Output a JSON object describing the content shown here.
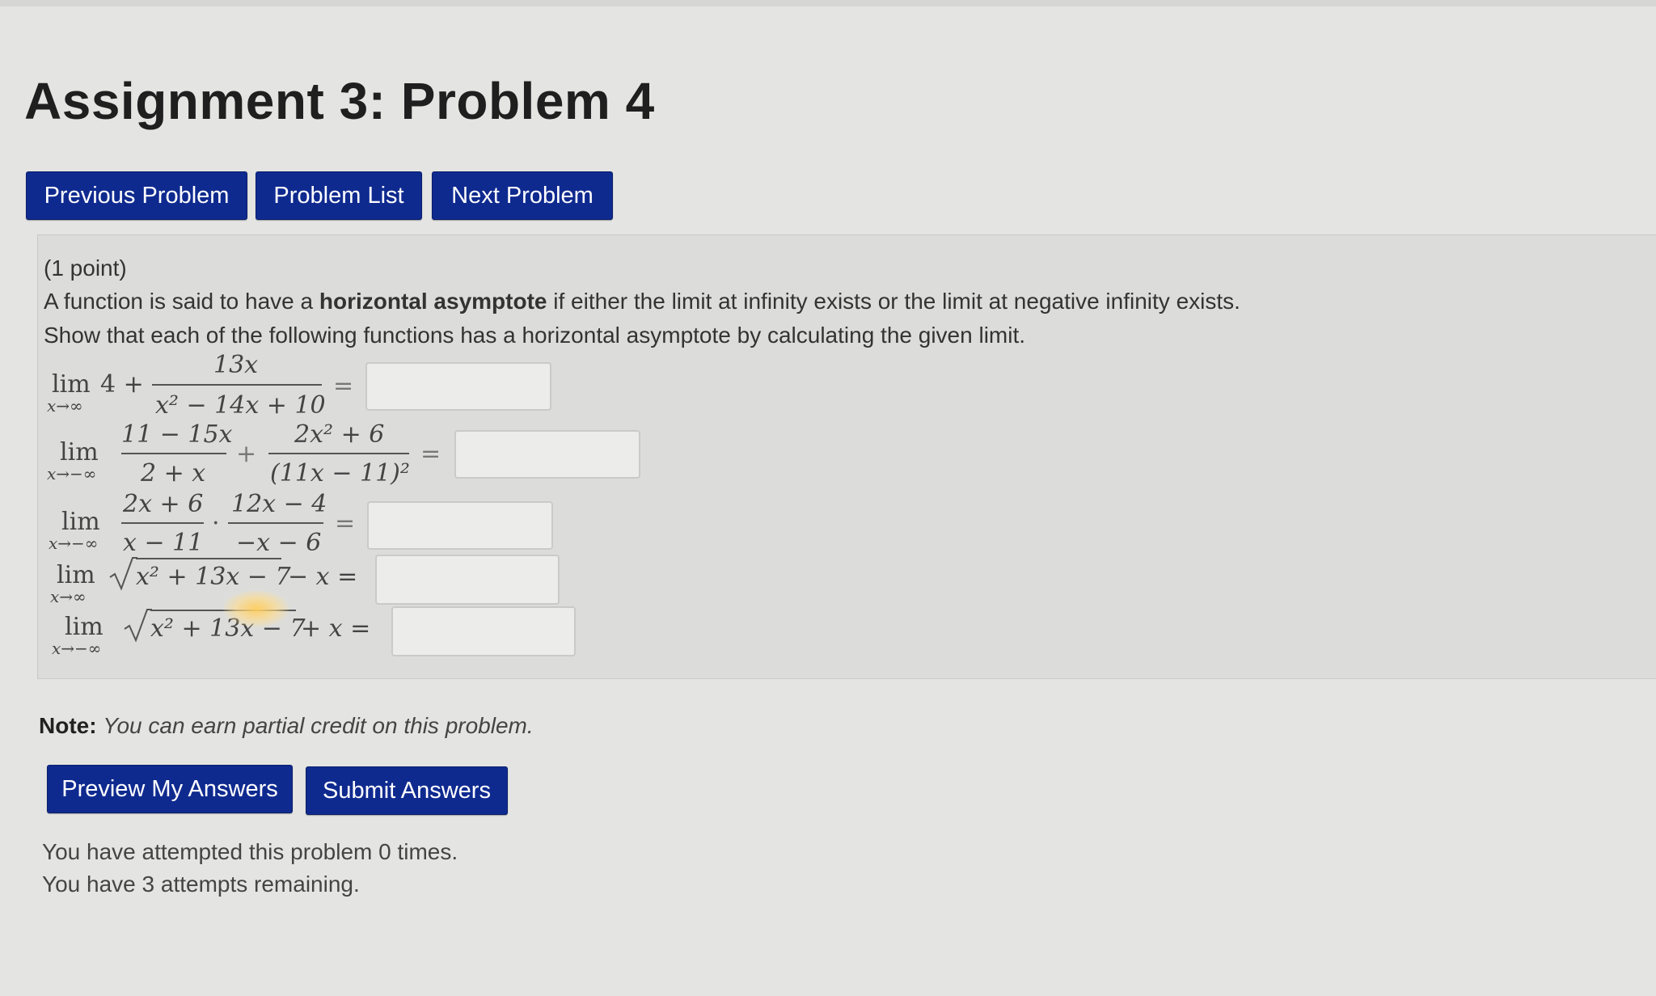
{
  "page": {
    "title": "Assignment 3: Problem 4"
  },
  "nav": {
    "previous": "Previous Problem",
    "list": "Problem List",
    "next": "Next Problem"
  },
  "problem": {
    "points": "(1 point)",
    "intro_part1": "A function is said to have a ",
    "intro_bold": "horizontal asymptote",
    "intro_part2": " if either the limit at infinity exists or the limit at negative infinity exists.",
    "instruction": "Show that each of the following functions has a horizontal asymptote by calculating the given limit.",
    "limits": [
      {
        "lim": "lim",
        "sub": "x→∞",
        "lead": "4 +",
        "num": "13x",
        "den": "x² − 14x + 10",
        "eq": "="
      },
      {
        "lim": "lim",
        "sub": "x→−∞",
        "num1": "11 − 15x",
        "den1": "2 + x",
        "plus": "+",
        "num2": "2x² + 6",
        "den2": "(11x − 11)²",
        "eq": "="
      },
      {
        "lim": "lim",
        "sub": "x→−∞",
        "num1": "2x + 6",
        "den1": "x − 11",
        "dot": "·",
        "num2": "12x − 4",
        "den2": "−x − 6",
        "eq": "="
      },
      {
        "lim": "lim",
        "sub": "x→∞",
        "radicand": "x² + 13x − 7",
        "tail": "− x =",
        "eq": ""
      },
      {
        "lim": "lim",
        "sub": "x→−∞",
        "radicand": "x² + 13x − 7",
        "tail": "+ x =",
        "eq": ""
      }
    ],
    "answers": [
      "",
      "",
      "",
      "",
      ""
    ]
  },
  "note": {
    "label": "Note:",
    "text": "You can earn partial credit on this problem."
  },
  "actions": {
    "preview": "Preview My Answers",
    "submit": "Submit Answers"
  },
  "status": {
    "attempted": "You have attempted this problem 0 times.",
    "remaining": "You have 3 attempts remaining."
  },
  "colors": {
    "button_bg": "#0f2a8f",
    "page_bg": "#e4e5e3"
  }
}
